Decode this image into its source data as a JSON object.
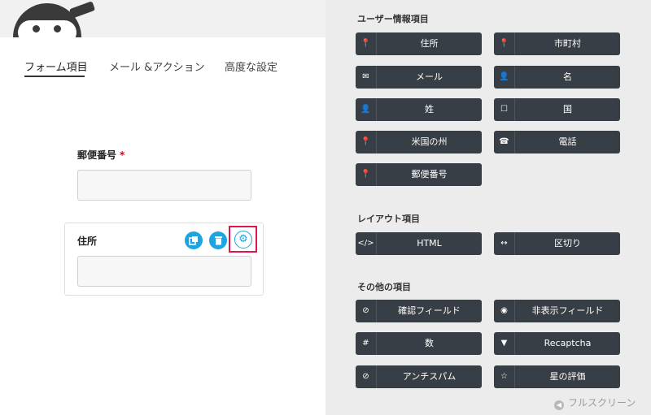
{
  "tabs": [
    {
      "label": "フォーム項目"
    },
    {
      "label": "メール &アクション"
    },
    {
      "label": "高度な設定"
    }
  ],
  "form": {
    "postal_field": {
      "label": "郵便番号",
      "required_mark": "*"
    },
    "address_field": {
      "label": "住所"
    },
    "actions": {
      "duplicate_icon": "duplicate-icon",
      "delete_icon": "trash-icon",
      "settings_icon": "gear-icon"
    }
  },
  "sections": {
    "user_info": {
      "title": "ユーザー情報項目",
      "buttons": [
        {
          "label": "住所",
          "icon": "map-pin-icon"
        },
        {
          "label": "市町村",
          "icon": "map-pin-icon"
        },
        {
          "label": "メール",
          "icon": "envelope-icon"
        },
        {
          "label": "名",
          "icon": "user-icon"
        },
        {
          "label": "姓",
          "icon": "user-icon"
        },
        {
          "label": "国",
          "icon": "square-icon"
        },
        {
          "label": "米国の州",
          "icon": "map-pin-icon"
        },
        {
          "label": "電話",
          "icon": "phone-icon"
        },
        {
          "label": "郵便番号",
          "icon": "map-pin-icon"
        }
      ]
    },
    "layout": {
      "title": "レイアウト項目",
      "buttons": [
        {
          "label": "HTML",
          "icon": "code-icon"
        },
        {
          "label": "区切り",
          "icon": "horizontal-arrows-icon"
        }
      ]
    },
    "other": {
      "title": "その他の項目",
      "buttons": [
        {
          "label": "確認フィールド",
          "icon": "check-circle-icon"
        },
        {
          "label": "非表示フィールド",
          "icon": "eye-slash-icon"
        },
        {
          "label": "数",
          "icon": "hash-icon"
        },
        {
          "label": "Recaptcha",
          "icon": "filter-icon"
        },
        {
          "label": "アンチスパム",
          "icon": "ban-icon"
        },
        {
          "label": "星の評価",
          "icon": "star-icon"
        }
      ]
    }
  },
  "fullscreen_label": "フルスクリーン",
  "colors": {
    "accent": "#1ea4e0",
    "highlight": "#e0144f",
    "button_bg": "#383e45",
    "panel_bg": "#ececed",
    "required": "#d0021b"
  }
}
